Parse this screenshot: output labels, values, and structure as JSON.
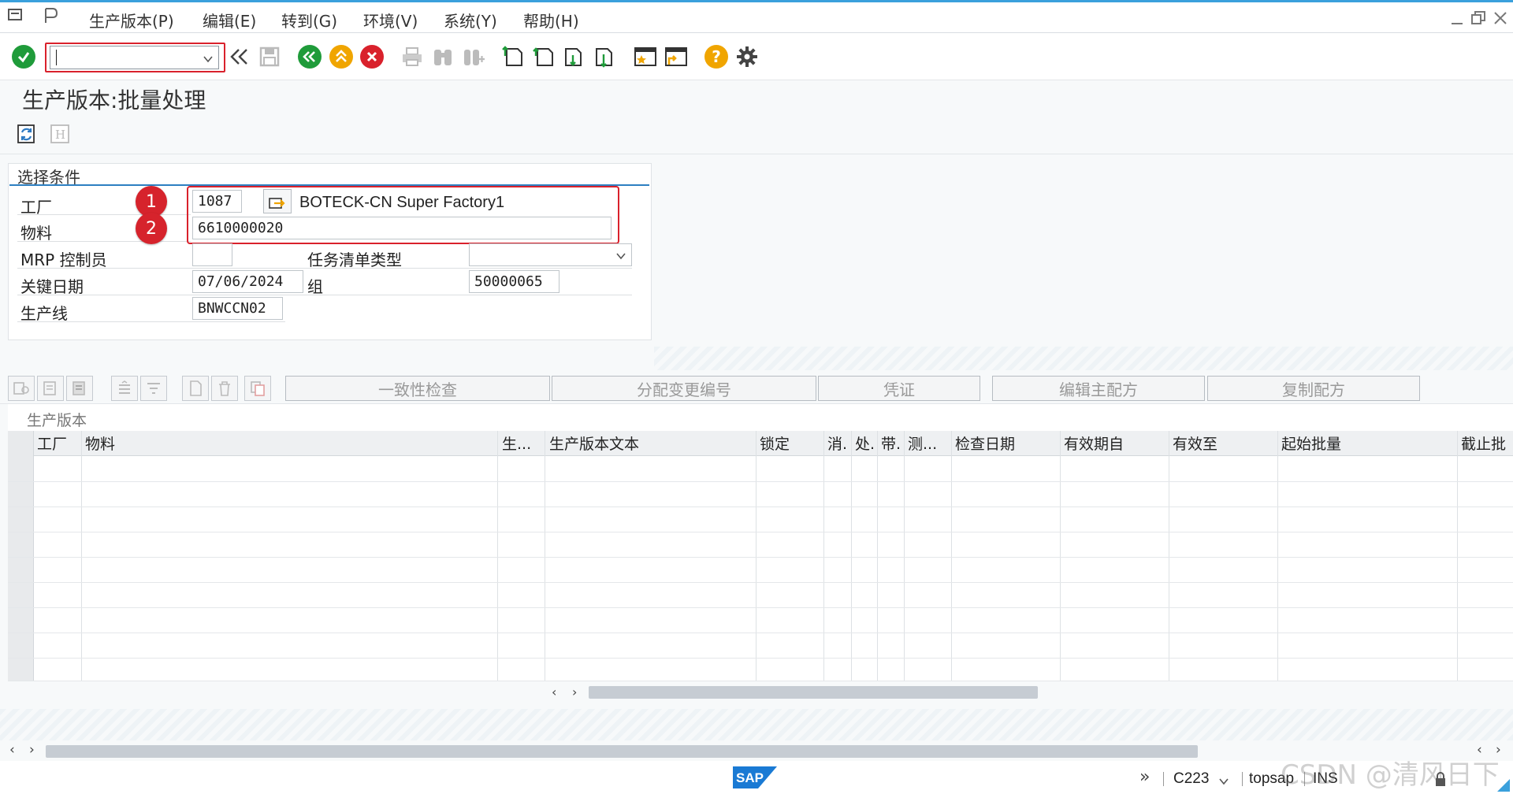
{
  "menu": {
    "items": [
      "生产版本(P)",
      "编辑(E)",
      "转到(G)",
      "环境(V)",
      "系统(Y)",
      "帮助(H)"
    ]
  },
  "toolbar": {
    "command_value": "",
    "icons": [
      "enter-icon",
      "command-field",
      "back-double-icon",
      "save-icon",
      "back-icon",
      "exit-icon",
      "cancel-icon",
      "print-icon",
      "find-icon",
      "find-next-icon",
      "first-page-icon",
      "prev-page-icon",
      "next-page-icon",
      "last-page-icon",
      "new-session-icon",
      "shortcut-icon",
      "help-icon",
      "settings-icon"
    ]
  },
  "page": {
    "title": "生产版本:批量处理"
  },
  "selection": {
    "title": "选择条件",
    "plant_label": "工厂",
    "plant_value": "1087",
    "plant_desc": "BOTECK-CN Super Factory1",
    "material_label": "物料",
    "material_value": "6610000020",
    "mrp_label": "MRP 控制员",
    "mrp_value": "",
    "tasklist_type_label": "任务清单类型",
    "tasklist_type_value": "",
    "key_date_label": "关键日期",
    "key_date_value": "07/06/2024",
    "group_label": "组",
    "group_value": "50000065",
    "prod_line_label": "生产线",
    "prod_line_value": "BNWCCN02"
  },
  "annotations": [
    "1",
    "2"
  ],
  "actions": {
    "consistency_check": "一致性检查",
    "assign_change_number": "分配变更编号",
    "voucher": "凭证",
    "edit_master_recipe": "编辑主配方",
    "copy_recipe": "复制配方"
  },
  "table": {
    "title": "生产版本",
    "columns": [
      "工厂",
      "物料",
      "生...",
      "生产版本文本",
      "锁定",
      "消.",
      "处.",
      "带.",
      "测...",
      "检查日期",
      "有效期自",
      "有效至",
      "起始批量",
      "截止批"
    ],
    "rows": []
  },
  "status": {
    "system": "C223",
    "server": "topsap",
    "mode": "INS",
    "logo": "SAP",
    "watermark": "CSDN @清风日下"
  },
  "colors": {
    "accent": "#3aa0dc",
    "highlight_red": "#d9212c",
    "enter_green": "#1f9b3a",
    "back_green": "#1f9b3a",
    "exit_orange": "#f0a500",
    "cancel_red": "#d9212c"
  }
}
